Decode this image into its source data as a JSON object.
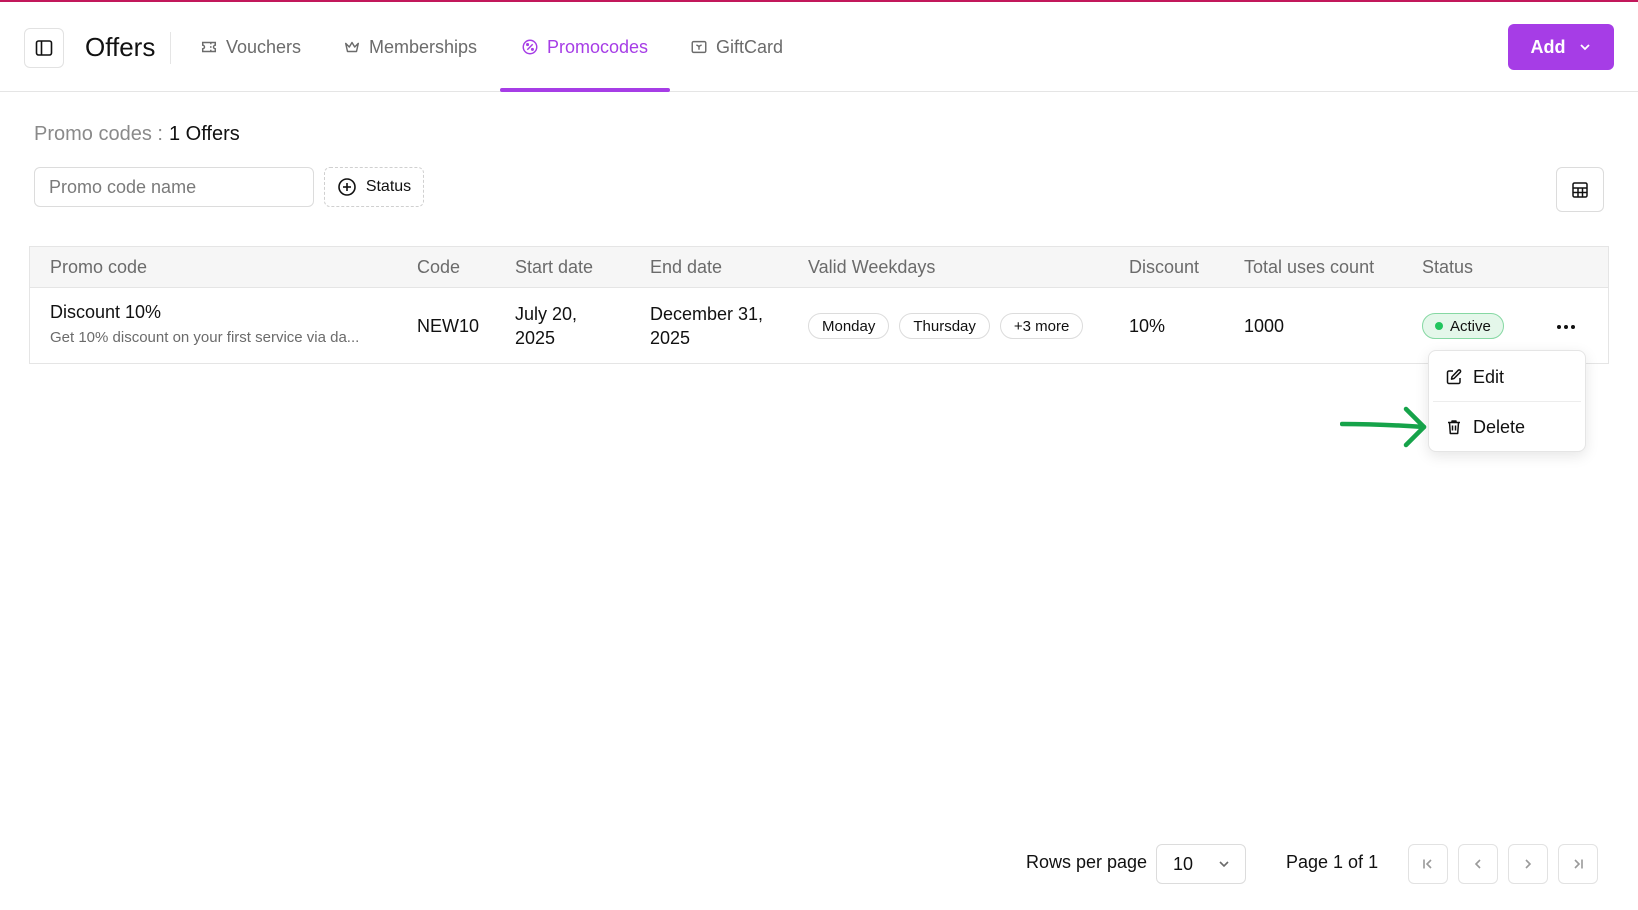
{
  "header": {
    "title": "Offers",
    "tabs": [
      {
        "label": "Vouchers",
        "icon": "ticket-icon",
        "active": false
      },
      {
        "label": "Memberships",
        "icon": "crown-icon",
        "active": false
      },
      {
        "label": "Promocodes",
        "icon": "badge-percent-icon",
        "active": true
      },
      {
        "label": "GiftCard",
        "icon": "gift-card-icon",
        "active": false
      }
    ],
    "add_label": "Add"
  },
  "summary": {
    "label": "Promo codes :",
    "count": "1 Offers"
  },
  "filters": {
    "search_placeholder": "Promo code name",
    "status_label": "Status"
  },
  "table": {
    "columns": [
      "Promo code",
      "Code",
      "Start date",
      "End date",
      "Valid Weekdays",
      "Discount",
      "Total uses count",
      "Status"
    ],
    "rows": [
      {
        "name": "Discount 10%",
        "description": "Get 10% discount on your first service via da...",
        "code": "NEW10",
        "start_line1": "July 20,",
        "start_line2": "2025",
        "end_line1": "December 31,",
        "end_line2": "2025",
        "weekdays": [
          "Monday",
          "Thursday"
        ],
        "more_weekdays": "+3 more",
        "discount": "10%",
        "uses": "1000",
        "status": "Active"
      }
    ]
  },
  "row_menu": {
    "edit_label": "Edit",
    "delete_label": "Delete"
  },
  "pagination": {
    "rows_label": "Rows per page",
    "rows_value": "10",
    "page_info": "Page 1 of 1"
  },
  "colors": {
    "accent": "#a63de6",
    "active_status": "#22c55e",
    "annotation_arrow": "#16a34a",
    "top_border": "#c2185b"
  }
}
